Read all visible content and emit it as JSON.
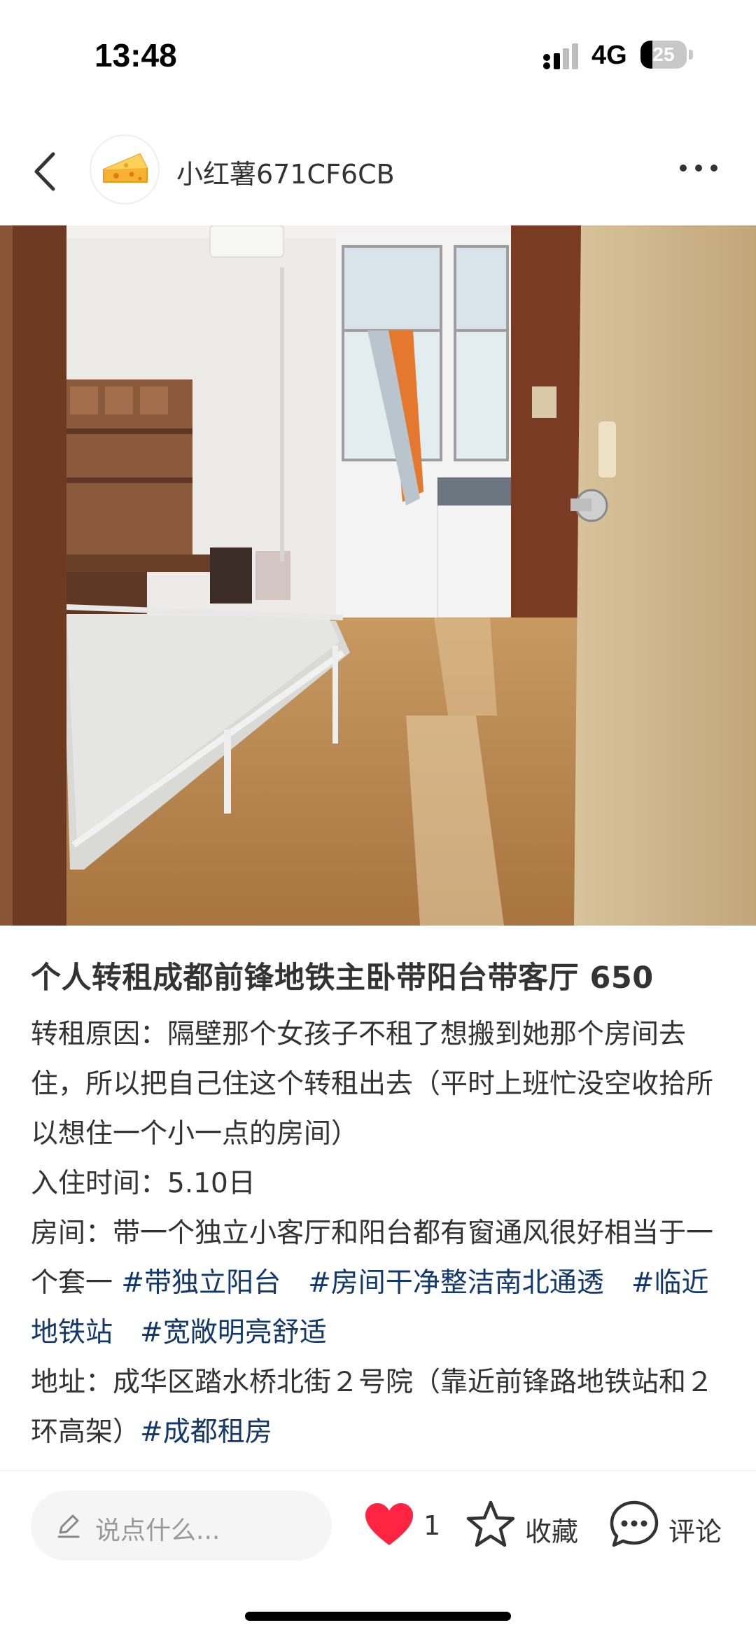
{
  "status_bar": {
    "time": "13:48",
    "network": "4G",
    "battery_level": "25",
    "battery_percent": 25,
    "icons": [
      "signal-icon",
      "battery-icon"
    ]
  },
  "header": {
    "author_name": "小红薯671CF6CB",
    "icons": [
      "back-arrow-icon",
      "cheese-avatar-icon",
      "more-dots-icon"
    ]
  },
  "photo": {
    "description_icon": "room-photo"
  },
  "post": {
    "title": "个人转租成都前锋地铁主卧带阳台带客厅 650",
    "reason_line": "转租原因：隔壁那个女孩子不租了想搬到她那个房间去住，所以把自己住这个转租出去（平时上班忙没空收拾所以想住一个小一点的房间）",
    "movein_line": "入住时间：5.10日",
    "room_text": "房间：带一个独立小客厅和阳台都有窗通风很好相当于一个套一 ",
    "room_tags": [
      "#带独立阳台",
      "#房间干净整洁南北通透",
      "#临近地铁站",
      "#宽敞明亮舒适"
    ],
    "address_text": "地址：成华区踏水桥北街２号院（靠近前锋路地铁站和２环高架）",
    "address_tag": "#成都租房"
  },
  "bottom_bar": {
    "comment_placeholder": "说点什么...",
    "like_count": "1",
    "collect_label": "收藏",
    "comment_label": "评论",
    "colors": {
      "like": "#ff2442",
      "tag": "#13386c"
    },
    "icons": [
      "pencil-icon",
      "heart-icon",
      "star-icon",
      "chat-bubble-icon"
    ]
  }
}
